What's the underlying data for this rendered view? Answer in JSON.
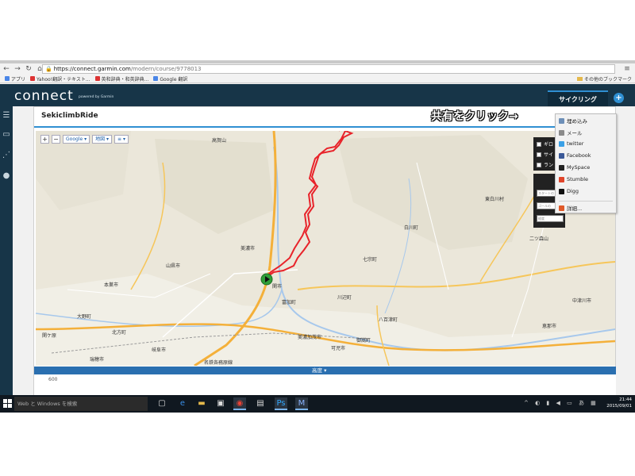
{
  "browser": {
    "url_host": "https://connect.garmin.com",
    "url_path": "/modern/course/9778013",
    "bookmarks": [
      "アプリ",
      "Yahoo!翻訳・テキスト...",
      "英和辞典・和英辞典...",
      "Google 翻訳"
    ],
    "bookmarks_right": "その他のブックマーク"
  },
  "app": {
    "logo": "connect",
    "powered_by": "powered by Garmin",
    "activity_tab": "サイクリング",
    "plus": "+"
  },
  "course": {
    "title": "SekiclimbRide",
    "annotation": "共有をクリック→",
    "share_label": "共有"
  },
  "map_controls": {
    "zoom_in": "+",
    "zoom_out": "−",
    "provider": "Google",
    "map_type": "地図",
    "layers": "≡"
  },
  "map_labels": [
    "高賀山",
    "美濃市",
    "関市",
    "山県市",
    "本巣市",
    "岐阜市",
    "美濃加茂市",
    "可児市",
    "瑞穂市",
    "大野町",
    "北方町",
    "七宗町",
    "白川町",
    "川辺町",
    "八百津町",
    "御嵩町",
    "中津川市",
    "恵那市",
    "東白川村",
    "二ツ森山",
    "富加町",
    "関ケ原",
    "名鉄各務原線"
  ],
  "overlay": {
    "checkbox_labels": [
      "ギロ",
      "サイ",
      "ラン"
    ],
    "stat_placeholders": [
      "スタートの",
      "ゴールの",
      "経度"
    ]
  },
  "share_menu": {
    "items": [
      {
        "label": "埋め込み",
        "icon": "embed-icon",
        "color": "#6d8fb8"
      },
      {
        "label": "メール",
        "icon": "mail-icon",
        "color": "#8a8a8a"
      },
      {
        "label": "twitter",
        "icon": "twitter-icon",
        "color": "#3aa0e6"
      },
      {
        "label": "Facebook",
        "icon": "facebook-icon",
        "color": "#3b5998"
      },
      {
        "label": "MySpace",
        "icon": "myspace-icon",
        "color": "#222222"
      },
      {
        "label": "Stumble",
        "icon": "stumble-icon",
        "color": "#e0452b"
      },
      {
        "label": "Digg",
        "icon": "digg-icon",
        "color": "#111111"
      },
      {
        "label": "詳細...",
        "icon": "more-icon",
        "color": "#e05a2a"
      }
    ]
  },
  "elevation": {
    "label": "高度 ▾",
    "y_max": "600"
  },
  "taskbar": {
    "search": "Web と Windows を検索",
    "time": "21:44",
    "date": "2015/09/01"
  },
  "colors": {
    "header_bg": "#173548",
    "accent": "#2f8fd2",
    "route": "#e8232a",
    "annotation_text": "#ffffff"
  }
}
